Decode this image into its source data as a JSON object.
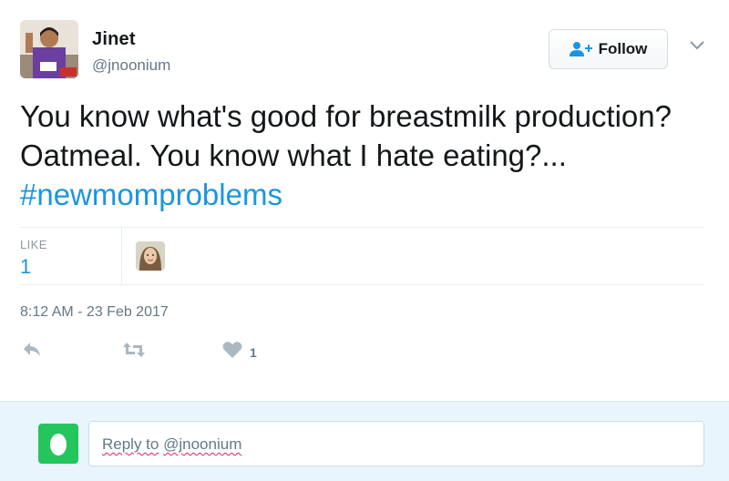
{
  "author": {
    "display_name": "Jinet",
    "handle": "@jnoonium",
    "avatar_icon": "runner-photo-avatar"
  },
  "follow_button": {
    "label": "Follow",
    "icon": "add-user-icon"
  },
  "more_menu": {
    "icon": "chevron-down-icon"
  },
  "tweet": {
    "text": "You know what's good for breastmilk production? Oatmeal. You know what I hate eating?... ",
    "hashtag": "#newmomproblems"
  },
  "stats": {
    "like_label": "LIKE",
    "like_count": "1",
    "liker_avatar_icon": "user-avatar"
  },
  "timestamp": "8:12 AM - 23 Feb 2017",
  "actions": {
    "reply_icon": "reply-icon",
    "retweet_icon": "retweet-icon",
    "like_icon": "heart-icon",
    "like_count": "1"
  },
  "reply_box": {
    "placeholder_prefix": "Reply to",
    "placeholder_handle": "@jnoonium"
  },
  "colors": {
    "link": "#1b95e0",
    "text": "#14171a",
    "secondary": "#657786",
    "reply_bar": "#e8f5fd",
    "egg_avatar": "#24c55c"
  }
}
